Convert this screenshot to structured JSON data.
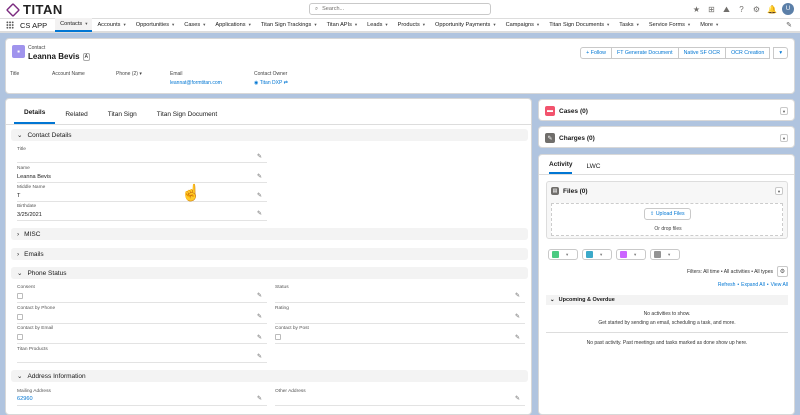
{
  "topbar": {
    "logo_text": "TITAN",
    "search_placeholder": "Search...",
    "avatar_label": "U"
  },
  "nav": {
    "app_name": "CS APP",
    "items": [
      {
        "label": "Contacts",
        "active": true
      },
      {
        "label": "Accounts"
      },
      {
        "label": "Opportunities"
      },
      {
        "label": "Cases"
      },
      {
        "label": "Applications"
      },
      {
        "label": "Titan Sign Trackings"
      },
      {
        "label": "Titan APIs"
      },
      {
        "label": "Leads"
      },
      {
        "label": "Products"
      },
      {
        "label": "Opportunity Payments"
      },
      {
        "label": "Campaigns"
      },
      {
        "label": "Titan Sign Documents"
      },
      {
        "label": "Tasks"
      },
      {
        "label": "Service Forms"
      },
      {
        "label": "More"
      }
    ]
  },
  "record": {
    "type": "Contact",
    "name": "Leanna Bevis",
    "badge": "A",
    "buttons": [
      "+ Follow",
      "FT Generate Document",
      "Native SF OCR",
      "OCR Creation"
    ],
    "fields": [
      {
        "label": "Title",
        "value": ""
      },
      {
        "label": "Account Name",
        "value": ""
      },
      {
        "label": "Phone (2)",
        "value": ""
      },
      {
        "label": "Email",
        "value": "leannat@formtitan.com"
      },
      {
        "label": "Contact Owner",
        "value": "Titan DXP"
      }
    ]
  },
  "tabs": [
    "Details",
    "Related",
    "Titan Sign",
    "Titan Sign Document"
  ],
  "sections": {
    "contact_details": "Contact Details",
    "misc": "MISC",
    "emails": "Emails",
    "phone_status": "Phone Status",
    "address": "Address Information"
  },
  "contact_fields": {
    "title_label": "Title",
    "name_label": "Name",
    "name_value": "Leanna Bevis",
    "middle_label": "Middle Name",
    "middle_value": "T",
    "birth_label": "Birthdate",
    "birth_value": "3/25/2021"
  },
  "phone_fields": {
    "consent": "Consent",
    "status": "Status",
    "contact_by_phone": "Contact by Phone",
    "rating": "Rating",
    "contact_by_email": "Contact by Email",
    "contact_by_post": "Contact by Post",
    "titan_products": "Titan Products"
  },
  "address_fields": {
    "mailing_label": "Mailing Address",
    "mailing_value": "62960",
    "other_label": "Other Address"
  },
  "right": {
    "cases": "Cases (0)",
    "charges": "Charges (0)",
    "activity_tabs": [
      "Activity",
      "LWC"
    ],
    "files": "Files (0)",
    "upload_button": "Upload Files",
    "drop_text": "Or drop files",
    "filters": "Filters: All time • All activities • All types",
    "refresh": "Refresh",
    "expand_all": "Expand All",
    "view_all": "View All",
    "upcoming": "Upcoming & Overdue",
    "no_activities": "No activities to show.",
    "get_started": "Get started by sending an email, scheduling a task, and more.",
    "no_past": "No past activity. Past meetings and tasks marked as done show up here."
  },
  "colors": {
    "brand": "#7b2b7f",
    "accent": "#0176d3",
    "contact_icon": "#a094ed",
    "cases_icon": "#f2536d",
    "charges_icon": "#706e6b"
  }
}
